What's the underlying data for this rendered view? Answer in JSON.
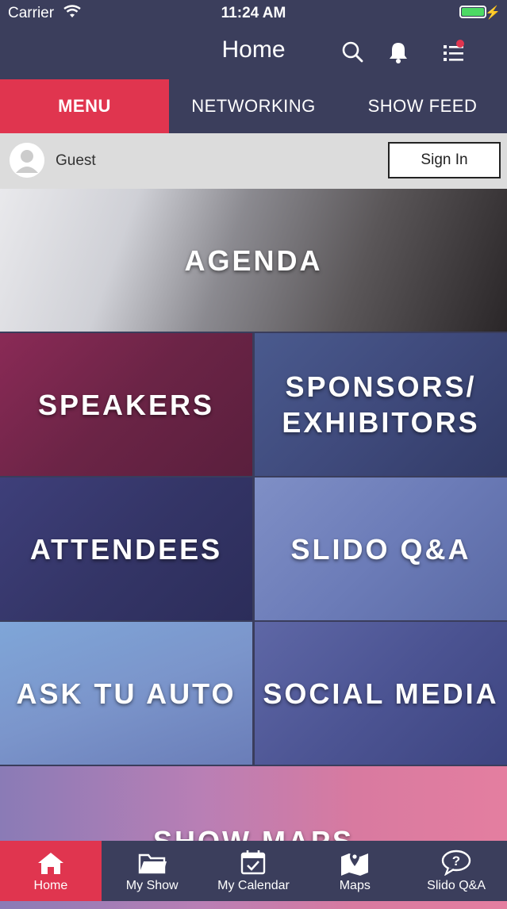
{
  "status_bar": {
    "carrier": "Carrier",
    "time": "11:24 AM"
  },
  "header": {
    "title": "Home"
  },
  "tabs": [
    {
      "label": "MENU"
    },
    {
      "label": "NETWORKING"
    },
    {
      "label": "SHOW FEED"
    }
  ],
  "guest_bar": {
    "name": "Guest",
    "signin_label": "Sign In"
  },
  "tiles": {
    "agenda": "AGENDA",
    "speakers": "SPEAKERS",
    "sponsors_line1": "SPONSORS/",
    "sponsors_line2": "EXHIBITORS",
    "attendees": "ATTENDEES",
    "slido": "SLIDO Q&A",
    "ask_tu_auto": "ASK TU AUTO",
    "social_media": "SOCIAL MEDIA",
    "show_maps": "SHOW MAPS"
  },
  "bottom_nav": [
    {
      "label": "Home",
      "icon": "home-icon"
    },
    {
      "label": "My Show",
      "icon": "folder-icon"
    },
    {
      "label": "My Calendar",
      "icon": "calendar-icon"
    },
    {
      "label": "Maps",
      "icon": "map-icon"
    },
    {
      "label": "Slido Q&A",
      "icon": "question-bubble-icon"
    }
  ],
  "colors": {
    "accent": "#e0354f",
    "nav_bg": "#3b3e5c",
    "battery": "#4cd964"
  }
}
